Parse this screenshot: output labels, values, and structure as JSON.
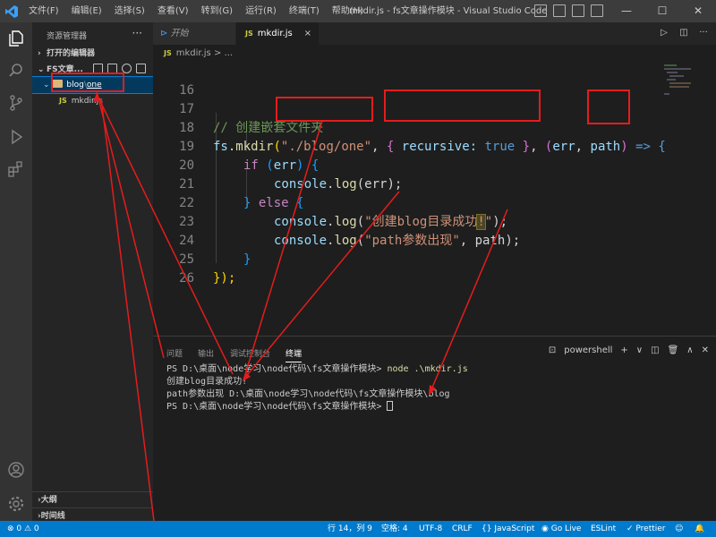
{
  "titlebar": {
    "menu": [
      "文件(F)",
      "编辑(E)",
      "选择(S)",
      "查看(V)",
      "转到(G)",
      "运行(R)",
      "终端(T)",
      "帮助(H)"
    ],
    "window_title": "mkdir.js - fs文章操作模块 - Visual Studio Code",
    "controls": [
      "—",
      "☐",
      "✕"
    ]
  },
  "sidebar": {
    "title": "资源管理器",
    "more": "···",
    "open_editors": "打开的编辑器",
    "folder": "FS文章...",
    "tree": {
      "folder_name": "blog",
      "separator": "\\",
      "subfolder": "one",
      "file_badge": "JS",
      "file_name": "mkdir.js"
    },
    "outline": "大纲",
    "timeline": "时间线"
  },
  "tabs": {
    "welcome": "开始",
    "file_badge": "JS",
    "file": "mkdir.js",
    "close": "×"
  },
  "breadcrumb": {
    "badge": "JS",
    "file": "mkdir.js",
    "sep": ">",
    "more": "..."
  },
  "editor": {
    "line_numbers": [
      "16",
      "17",
      "18",
      "19",
      "20",
      "21",
      "22",
      "23",
      "24",
      "25",
      "26"
    ],
    "code": {
      "comment": "// 创建嵌套文件夹",
      "l18_obj": "fs",
      "l18_dot": ".",
      "l18_fn": "mkdir",
      "l18_open": "(",
      "l18_path": "\"./blog/one\"",
      "l18_comma": ", ",
      "l18_brace_open": "{ ",
      "l18_key": "recursive",
      "l18_colon": ": ",
      "l18_true": "true",
      "l18_brace_close": " }",
      "l18_comma2": ", ",
      "l18_paren": "(",
      "l18_err": "err",
      "l18_comma3": ", ",
      "l18_arg": "path",
      "l18_paren_close": ")",
      "l18_arrow": " => {",
      "l19_if": "if",
      "l19_open": " (",
      "l19_err": "err",
      "l19_close": ") {",
      "console": "console",
      "dot": ".",
      "log": "log",
      "l20_args": "(err);",
      "l21_close": "} ",
      "l21_else": "else",
      "l21_open": " {",
      "l22_open": "(",
      "l22_str_a": "\"创建blog目录成功",
      "l22_excl": "!",
      "l22_str_b": "\"",
      "l22_close": ");",
      "l23_open": "(",
      "l23_str": "\"path参数出现\"",
      "l23_rest": ", path);",
      "l24": "}",
      "l25": "});"
    }
  },
  "panel": {
    "tabs": [
      "问题",
      "输出",
      "调试控制台",
      "终端"
    ],
    "shell": "powershell",
    "tools": [
      "+",
      "∨",
      "◫",
      "🗑",
      "∧",
      "✕"
    ],
    "terminal": {
      "prompt1": "PS D:\\桌面\\node学习\\node代码\\fs文章操作模块> ",
      "cmd1": "node .\\mkdir.js",
      "out1": "创建blog目录成功!",
      "out2": "path参数出现 D:\\桌面\\node学习\\node代码\\fs文章操作模块\\blog",
      "prompt2": "PS D:\\桌面\\node学习\\node代码\\fs文章操作模块> "
    }
  },
  "statusbar": {
    "errors": "⊗ 0 ⚠ 0",
    "position": "行 14，列 9",
    "spaces": "空格: 4",
    "encoding": "UTF-8",
    "eol": "CRLF",
    "language": "{} JavaScript",
    "golive": "◉ Go Live",
    "eslint": "ESLint",
    "prettier": "✓ Prettier"
  },
  "colors": {
    "annotation": "#e51c1c",
    "statusbar": "#007acc"
  }
}
